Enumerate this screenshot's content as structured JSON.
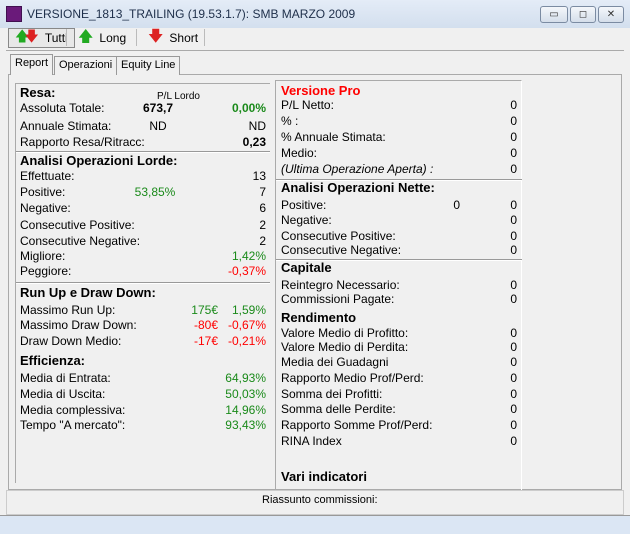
{
  "window": {
    "title": "VERSIONE_1813_TRAILING (19.53.1.7): SMB MARZO 2009",
    "min": "▭",
    "max": "◻",
    "close": "✕"
  },
  "toolbar": [
    {
      "label": "Tutti",
      "icon": "up-down-arrows-icon"
    },
    {
      "label": "Long",
      "icon": "green-up-arrow-icon"
    },
    {
      "label": "Short",
      "icon": "red-down-arrow-icon"
    }
  ],
  "tabs": [
    "Report",
    "Operazioni",
    "Equity Line"
  ],
  "colors": {
    "green": "#1a8a1a",
    "red": "#ff0000",
    "title_red": "#ff0000"
  },
  "left": {
    "resa": {
      "title": "Resa:",
      "pl_header": "P/L Lordo",
      "rows": [
        {
          "label": "Assoluta Totale:",
          "mid": "673,7",
          "val": "0,00%",
          "vc": "green",
          "bold": true
        },
        {
          "label": "Annuale Stimata:",
          "mid": "ND",
          "val": "ND"
        },
        {
          "label": "Rapporto Resa/Ritracc:",
          "val": "0,23",
          "bold": true
        }
      ]
    },
    "lorde": {
      "title": "Analisi Operazioni Lorde:",
      "rows": [
        {
          "label": "Effettuate:",
          "val": "13"
        },
        {
          "label": "Positive:",
          "mid": "53,85%",
          "mc": "green",
          "val": "7"
        },
        {
          "label": "Negative:",
          "val": "6"
        },
        {
          "label": "Consecutive Positive:",
          "val": "2"
        },
        {
          "label": "Consecutive Negative:",
          "val": "2"
        },
        {
          "label": "Migliore:",
          "val": "1,42%",
          "vc": "green"
        },
        {
          "label": "Peggiore:",
          "val": "-0,37%",
          "vc": "red"
        }
      ]
    },
    "runup": {
      "title": "Run Up e Draw Down:",
      "rows": [
        {
          "label": "Massimo Run Up:",
          "mid": "175€",
          "mc": "green",
          "val": "1,59%",
          "vc": "green"
        },
        {
          "label": "Massimo Draw Down:",
          "mid": "-80€",
          "mc": "red",
          "val": "-0,67%",
          "vc": "red"
        },
        {
          "label": "Draw Down Medio:",
          "mid": "-17€",
          "mc": "red",
          "val": "-0,21%",
          "vc": "red"
        }
      ]
    },
    "efficienza": {
      "title": "Efficienza:",
      "rows": [
        {
          "label": "Media di Entrata:",
          "val": "64,93%",
          "vc": "green"
        },
        {
          "label": "Media di Uscita:",
          "val": "50,03%",
          "vc": "green"
        },
        {
          "label": "Media complessiva:",
          "val": "14,96%",
          "vc": "green"
        },
        {
          "label": "Tempo \"A mercato\":",
          "val": "93,43%",
          "vc": "green"
        }
      ]
    }
  },
  "right": {
    "pro": {
      "title": "Versione Pro",
      "rows": [
        {
          "label": "P/L Netto:",
          "val": "0"
        },
        {
          "label": "% :",
          "val": "0"
        },
        {
          "label": "% Annuale Stimata:",
          "val": "0"
        },
        {
          "label": "Medio:",
          "val": "0"
        },
        {
          "label": "(Ultima Operazione Aperta) :",
          "val": "0",
          "italic": true
        }
      ]
    },
    "nette": {
      "title": "Analisi Operazioni Nette:",
      "rows": [
        {
          "label": "Positive:",
          "mid": "0",
          "val": "0"
        },
        {
          "label": "Negative:",
          "val": "0"
        },
        {
          "label": "Consecutive Positive:",
          "val": "0"
        },
        {
          "label": "Consecutive Negative:",
          "val": "0"
        }
      ]
    },
    "capitale": {
      "title": "Capitale",
      "rows": [
        {
          "label": "Reintegro Necessario:",
          "val": "0"
        },
        {
          "label": "Commissioni Pagate:",
          "val": "0"
        }
      ]
    },
    "rendimento": {
      "title": "Rendimento",
      "rows": [
        {
          "label": "Valore Medio di Profitto:",
          "val": "0"
        },
        {
          "label": "Valore Medio di Perdita:",
          "val": "0"
        },
        {
          "label": "Media dei Guadagni",
          "val": "0"
        },
        {
          "label": "Rapporto Medio Prof/Perd:",
          "val": "0"
        },
        {
          "label": "Somma dei Profitti:",
          "val": "0"
        },
        {
          "label": "Somma delle Perdite:",
          "val": "0"
        },
        {
          "label": "Rapporto Somme Prof/Perd:",
          "val": "0"
        },
        {
          "label": "RINA Index",
          "val": "0"
        }
      ]
    },
    "vari": {
      "title": "Vari indicatori"
    }
  },
  "status": {
    "label": "Riassunto commissioni:"
  }
}
